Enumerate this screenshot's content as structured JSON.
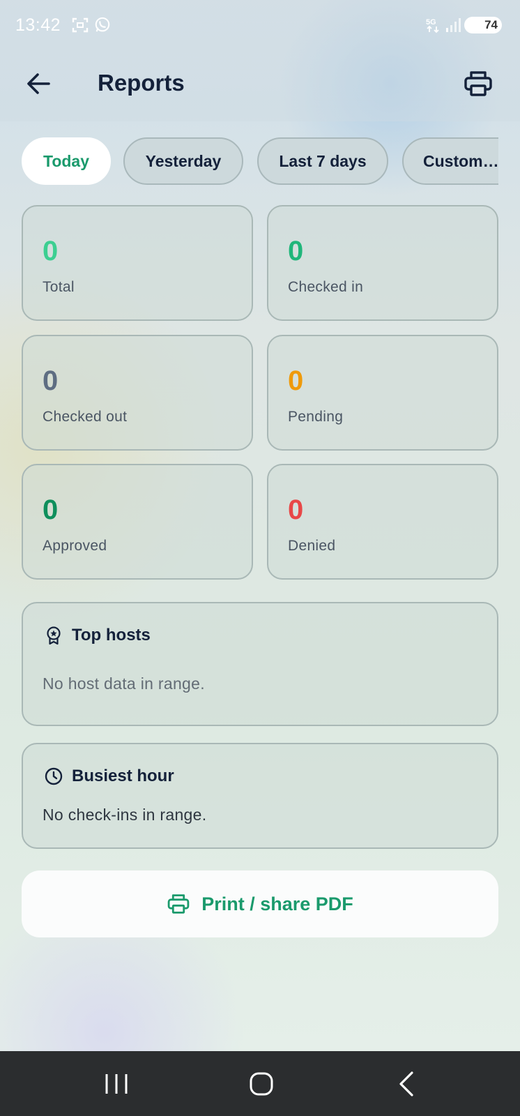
{
  "status_bar": {
    "time": "13:42",
    "battery": "74",
    "icons": [
      "screenshot-icon",
      "whatsapp-icon",
      "5g-icon",
      "signal-icon",
      "battery-icon"
    ]
  },
  "header": {
    "title": "Reports",
    "back_icon": "arrow-left-icon",
    "print_icon": "printer-icon"
  },
  "range_tabs": [
    {
      "label": "Today",
      "active": true
    },
    {
      "label": "Yesterday",
      "active": false
    },
    {
      "label": "Last 7 days",
      "active": false
    },
    {
      "label": "Custom…",
      "active": false
    }
  ],
  "stats": {
    "total": {
      "value": "0",
      "label": "Total",
      "color": "#3ccf91"
    },
    "checked_in": {
      "value": "0",
      "label": "Checked in",
      "color": "#1fb67a"
    },
    "checked_out": {
      "value": "0",
      "label": "Checked out",
      "color": "#5e6d82"
    },
    "pending": {
      "value": "0",
      "label": "Pending",
      "color": "#ef9a0a"
    },
    "approved": {
      "value": "0",
      "label": "Approved",
      "color": "#0f8f5c"
    },
    "denied": {
      "value": "0",
      "label": "Denied",
      "color": "#e84747"
    }
  },
  "top_hosts": {
    "title": "Top hosts",
    "icon": "award-badge-icon",
    "empty_text": "No host data in range."
  },
  "busiest_hour": {
    "title": "Busiest hour",
    "icon": "clock-icon",
    "empty_text": "No check-ins in range."
  },
  "pdf_button": {
    "label": "Print / share PDF",
    "icon": "printer-icon"
  },
  "colors": {
    "accent": "#1a9a6c",
    "title_text": "#14213a"
  },
  "nav_bar": {
    "buttons": [
      "recent-apps-icon",
      "home-icon",
      "back-nav-icon"
    ]
  }
}
